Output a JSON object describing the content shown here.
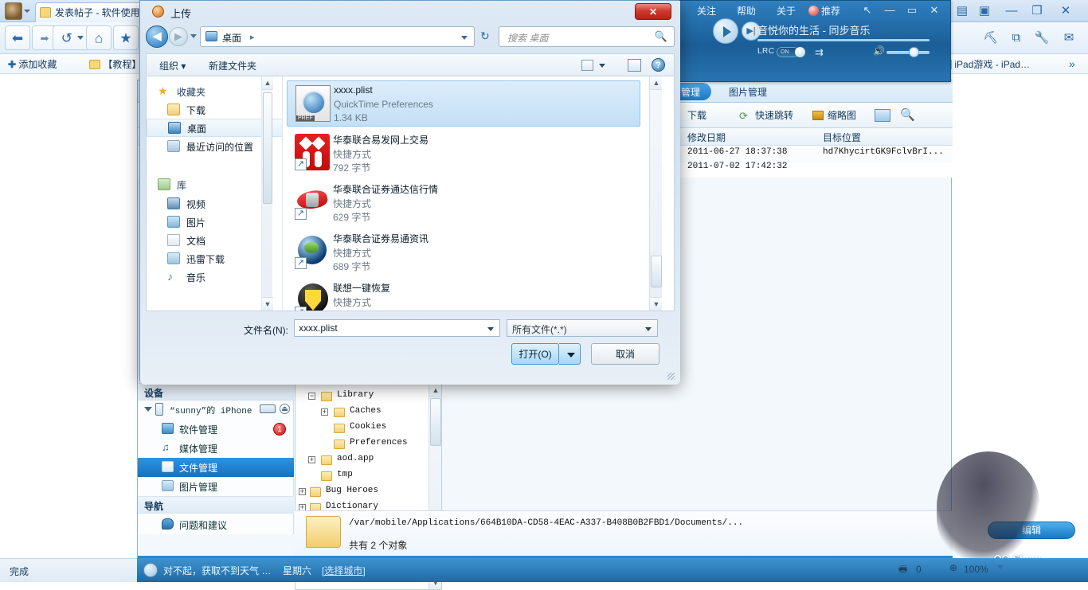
{
  "browser": {
    "tab_title": "发表帖子 - 软件使用…",
    "nav": {
      "back": "◀",
      "forward": "▶",
      "refresh": "↻",
      "home": "⌂",
      "favorite": "★"
    },
    "bookmarks": [
      {
        "label": "添加收藏",
        "icon": "plus-icon"
      },
      {
        "label": "【教程】",
        "icon": "bookmark-icon"
      },
      {
        "label": "iPad游戏 - iPad…",
        "icon": "page-icon"
      },
      {
        "label": "»",
        "icon": "chevron-double-right-icon"
      }
    ],
    "toolbar_icons": [
      "broom-icon",
      "screenshot-icon",
      "wrench-icon",
      "mail-icon"
    ],
    "window_buttons": [
      "chat-icon",
      "note-icon",
      "minimize-icon",
      "restore-icon",
      "close-icon"
    ],
    "status_text": "完成",
    "download_count": "0",
    "zoom_level": "100%"
  },
  "player": {
    "menu": [
      "关注",
      "帮助",
      "关于",
      "推荐"
    ],
    "recommend_icon": "weibo-icon",
    "window_buttons": [
      "pin-icon",
      "minimize-icon",
      "maximize-icon",
      "close-icon"
    ],
    "now_playing": "音悦你的生活 - 同步音乐",
    "lrc_label": "LRC",
    "lrc_state": "ON"
  },
  "itools": {
    "tabs": [
      {
        "label": "管理",
        "active": true
      },
      {
        "label": "图片管理",
        "active": false
      }
    ],
    "toolbar": [
      {
        "label": "下载",
        "icon": "download-icon"
      },
      {
        "label": "快速跳转",
        "icon": "jump-icon"
      },
      {
        "label": "缩略图",
        "icon": "thumbnail-icon"
      },
      {
        "label": "",
        "icon": "split-view-icon"
      },
      {
        "label": "",
        "icon": "search-icon"
      }
    ],
    "columns": [
      "修改日期",
      "目标位置"
    ],
    "rows": [
      {
        "date": "2011-06-27 18:37:38",
        "target": "hd7KhycirtGK9FclvBrI..."
      },
      {
        "date": "2011-07-02 17:42:32",
        "target": ""
      }
    ],
    "device_header": "设备",
    "device_name": "“sunny”的 iPhone",
    "device_items": [
      {
        "label": "软件管理",
        "badge": "1",
        "selected": false
      },
      {
        "label": "媒体管理",
        "badge": "",
        "selected": false
      },
      {
        "label": "文件管理",
        "badge": "",
        "selected": true
      },
      {
        "label": "图片管理",
        "badge": "",
        "selected": false
      }
    ],
    "nav_header": "导航",
    "nav_items": [
      {
        "label": "问题和建议"
      }
    ],
    "tree": [
      {
        "label": "Library",
        "indent": 0,
        "expander": "−"
      },
      {
        "label": "Caches",
        "indent": 1,
        "expander": "+"
      },
      {
        "label": "Cookies",
        "indent": 1,
        "expander": ""
      },
      {
        "label": "Preferences",
        "indent": 1,
        "expander": ""
      },
      {
        "label": "aod.app",
        "indent": 0,
        "expander": "+"
      },
      {
        "label": "tmp",
        "indent": 0,
        "expander": ""
      },
      {
        "label": "Bug Heroes",
        "indent": -1,
        "expander": "+"
      },
      {
        "label": "Dictionary",
        "indent": -1,
        "expander": "+"
      }
    ],
    "status_path": "/var/mobile/Applications/664B10DA-CD58-4EAC-A337-B408B0B2FBD1/Documents/...",
    "status_count": "共有 2 个对象",
    "edit_button": "编辑"
  },
  "weather": {
    "message": "对不起，获取不到天气 …",
    "weekday": "星期六",
    "city_link": "[选择城市]"
  },
  "qqshow": {
    "label": "QQ Show"
  },
  "dialog": {
    "title": "上传",
    "close_label": "✕",
    "address": {
      "icon": "desktop-icon",
      "path": "桌面",
      "separator": "▸"
    },
    "search": {
      "placeholder": "搜索 桌面",
      "icon": "search-icon"
    },
    "commands": [
      {
        "label": "组织 ▾",
        "name": "organize-menu"
      },
      {
        "label": "新建文件夹",
        "name": "new-folder-button"
      }
    ],
    "command_icons": [
      "view-mode-icon",
      "chevron-down-icon",
      "preview-pane-icon",
      "help-icon"
    ],
    "nav_pane": [
      {
        "label": "收藏夹",
        "icon": "star-icon",
        "level": 0,
        "selected": false
      },
      {
        "label": "下载",
        "icon": "download-folder-icon",
        "level": 1,
        "selected": false
      },
      {
        "label": "桌面",
        "icon": "desktop-icon",
        "level": 1,
        "selected": true
      },
      {
        "label": "最近访问的位置",
        "icon": "recent-places-icon",
        "level": 1,
        "selected": false
      },
      {
        "label": "库",
        "icon": "library-icon",
        "level": 0,
        "selected": false
      },
      {
        "label": "视频",
        "icon": "video-icon",
        "level": 1,
        "selected": false
      },
      {
        "label": "图片",
        "icon": "picture-icon",
        "level": 1,
        "selected": false
      },
      {
        "label": "文档",
        "icon": "document-icon",
        "level": 1,
        "selected": false
      },
      {
        "label": "迅雷下载",
        "icon": "thunder-download-icon",
        "level": 1,
        "selected": false
      },
      {
        "label": "音乐",
        "icon": "music-icon",
        "level": 1,
        "selected": false
      }
    ],
    "files": [
      {
        "name": "xxxx.plist",
        "type": "QuickTime Preferences",
        "size": "1.34 KB",
        "icon": "quicktime-pref-icon",
        "selected": true,
        "shortcut": false
      },
      {
        "name": "华泰联合易发网上交易",
        "type": "快捷方式",
        "size": "792 字节",
        "icon": "huatai-trade-icon",
        "selected": false,
        "shortcut": true
      },
      {
        "name": "华泰联合证券通达信行情",
        "type": "快捷方式",
        "size": "629 字节",
        "icon": "tongdaxin-icon",
        "selected": false,
        "shortcut": true
      },
      {
        "name": "华泰联合证券易通资讯",
        "type": "快捷方式",
        "size": "689 字节",
        "icon": "yitong-news-icon",
        "selected": false,
        "shortcut": true
      },
      {
        "name": "联想一键恢复",
        "type": "快捷方式",
        "size": "",
        "icon": "lenovo-recovery-icon",
        "selected": false,
        "shortcut": true
      }
    ],
    "filename_label": "文件名(N):",
    "filename_value": "xxxx.plist",
    "filter_value": "所有文件(*.*)",
    "open_button": "打开(O)",
    "cancel_button": "取消"
  },
  "colors": {
    "aero_blue": "#2f86cf",
    "selection_blue": "#1372be",
    "close_red": "#d03a2d",
    "badge_red": "#cc1010"
  }
}
